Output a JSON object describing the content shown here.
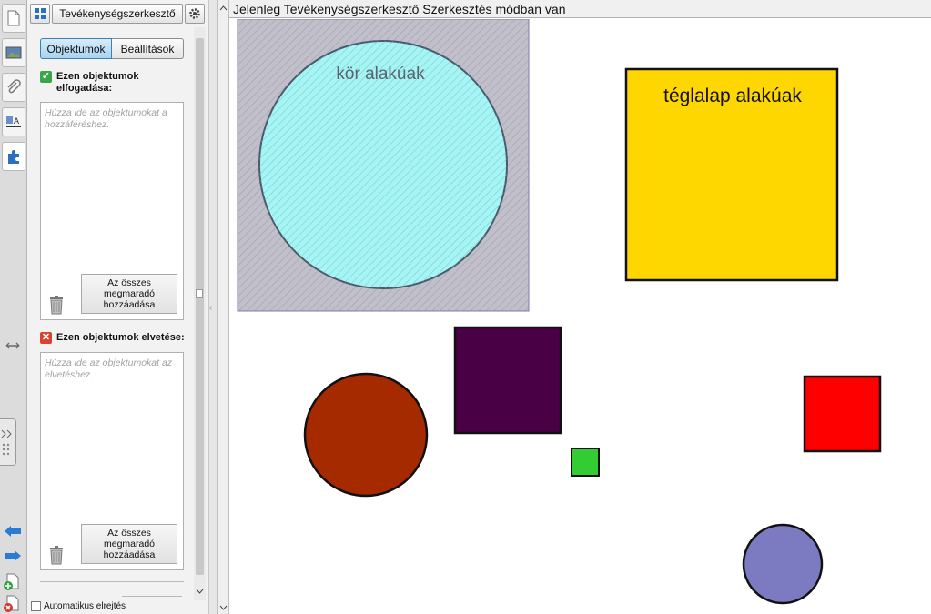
{
  "rail": {
    "tabs": [
      {
        "name": "page-sorter-icon"
      },
      {
        "name": "gallery-icon"
      },
      {
        "name": "attachments-icon"
      },
      {
        "name": "properties-icon"
      },
      {
        "name": "add-ons-icon"
      }
    ],
    "bottom_icons": [
      "back-arrow-icon",
      "forward-arrow-icon",
      "add-page-icon",
      "delete-page-icon"
    ]
  },
  "panel": {
    "title": "Tevékenységszerkesztő",
    "tabs": {
      "objects": "Objektumok",
      "settings": "Beállítások"
    },
    "accept": {
      "label": "Ezen objektumok elfogadása:",
      "hint": "Húzza ide az objektumokat a hozzáféréshez.",
      "button": "Az összes megmaradó hozzáadása"
    },
    "reject": {
      "label": "Ezen objektumok elvetése:",
      "hint": "Húzza ide az objektumokat az elvetéshez.",
      "button": "Az összes megmaradó hozzáadása"
    },
    "auto_hide": "Automatikus elrejtés"
  },
  "status": "Jelenleg Tevékenységszerkesztő Szerkesztés módban van",
  "canvas": {
    "circle_zone_label": "kör alakúak",
    "rect_zone_label": "téglalap alakúak",
    "colors": {
      "zone_bg": "#c0bfca",
      "circle_fill": "#a6f5f5",
      "yellow": "#ffd700",
      "purple": "#4a0045",
      "brown": "#a52a00",
      "green": "#33cc33",
      "red": "#ff0000",
      "lavender": "#7c7bc2"
    }
  }
}
